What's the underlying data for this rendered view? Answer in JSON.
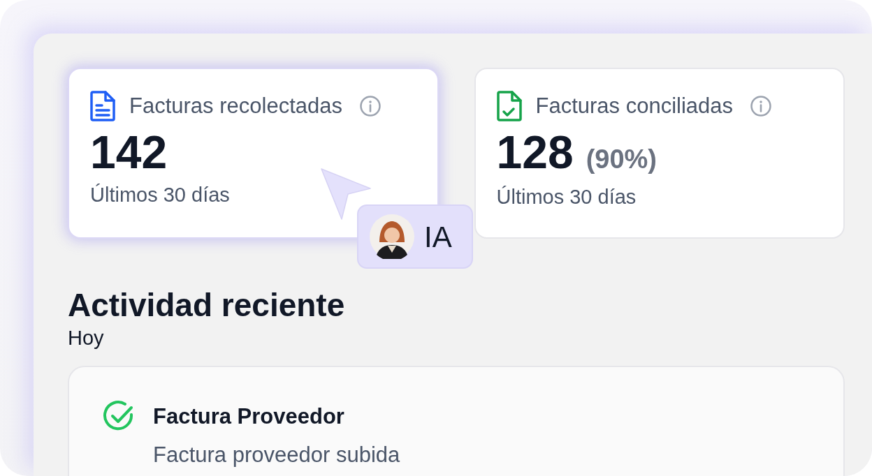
{
  "stats": [
    {
      "kind": "document",
      "title": "Facturas recolectadas",
      "value": "142",
      "subtitle": "Últimos 30 días",
      "highlighted": true
    },
    {
      "kind": "document-check",
      "title": "Facturas conciliadas",
      "value": "128",
      "percent": "(90%)",
      "subtitle": "Últimos 30 días",
      "highlighted": false
    }
  ],
  "cursor_badge": {
    "label": "IA"
  },
  "activity": {
    "title": "Actividad reciente",
    "day": "Hoy",
    "items": [
      {
        "completed": true,
        "title": "Factura Proveedor",
        "description": "Factura proveedor subida"
      }
    ]
  }
}
